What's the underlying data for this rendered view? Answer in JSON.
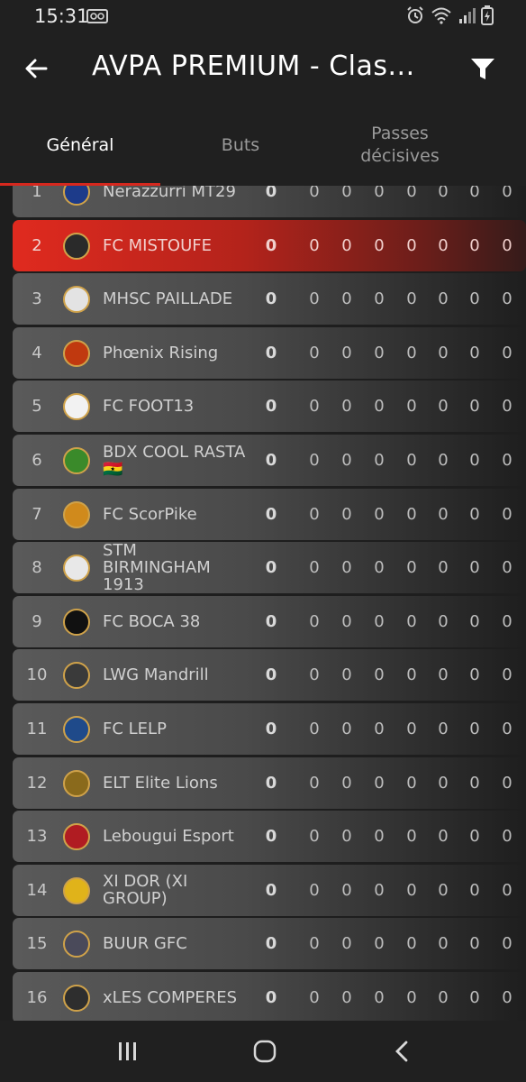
{
  "status_bar": {
    "time": "15:31"
  },
  "app_bar": {
    "title": "AVPA PREMIUM - Clas..."
  },
  "tabs": [
    {
      "label": "Général"
    },
    {
      "label": "Buts"
    },
    {
      "label": "Passes décisives"
    }
  ],
  "rows": [
    {
      "rank": "1",
      "team": "Nerazzurri MT29",
      "logo_color": "#1d3b8a",
      "stats": [
        "0",
        "0",
        "0",
        "0",
        "0",
        "0",
        "0",
        "0"
      ]
    },
    {
      "rank": "2",
      "team": "FC MISTOUFE",
      "logo_color": "#2a2a2a",
      "stats": [
        "0",
        "0",
        "0",
        "0",
        "0",
        "0",
        "0",
        "0"
      ]
    },
    {
      "rank": "3",
      "team": "MHSC PAILLADE",
      "logo_color": "#e3e3e3",
      "stats": [
        "0",
        "0",
        "0",
        "0",
        "0",
        "0",
        "0",
        "0"
      ]
    },
    {
      "rank": "4",
      "team": "Phœnix Rising",
      "logo_color": "#c0390f",
      "stats": [
        "0",
        "0",
        "0",
        "0",
        "0",
        "0",
        "0",
        "0"
      ]
    },
    {
      "rank": "5",
      "team": "FC FOOT13",
      "logo_color": "#f2f2f2",
      "stats": [
        "0",
        "0",
        "0",
        "0",
        "0",
        "0",
        "0",
        "0"
      ]
    },
    {
      "rank": "6",
      "team": "BDX COOL RASTA 🇬🇭",
      "logo_color": "#3a8a2a",
      "stats": [
        "0",
        "0",
        "0",
        "0",
        "0",
        "0",
        "0",
        "0"
      ]
    },
    {
      "rank": "7",
      "team": "FC ScorPike",
      "logo_color": "#d08a1c",
      "stats": [
        "0",
        "0",
        "0",
        "0",
        "0",
        "0",
        "0",
        "0"
      ]
    },
    {
      "rank": "8",
      "team": "STM BIRMINGHAM 1913",
      "logo_color": "#e8e8e8",
      "stats": [
        "0",
        "0",
        "0",
        "0",
        "0",
        "0",
        "0",
        "0"
      ]
    },
    {
      "rank": "9",
      "team": "FC BOCA 38",
      "logo_color": "#111111",
      "stats": [
        "0",
        "0",
        "0",
        "0",
        "0",
        "0",
        "0",
        "0"
      ]
    },
    {
      "rank": "10",
      "team": "LWG Mandrill",
      "logo_color": "#3a3a3a",
      "stats": [
        "0",
        "0",
        "0",
        "0",
        "0",
        "0",
        "0",
        "0"
      ]
    },
    {
      "rank": "11",
      "team": "FC LELP",
      "logo_color": "#1f4a8a",
      "stats": [
        "0",
        "0",
        "0",
        "0",
        "0",
        "0",
        "0",
        "0"
      ]
    },
    {
      "rank": "12",
      "team": "ELT Elite Lions",
      "logo_color": "#8a6a1c",
      "stats": [
        "0",
        "0",
        "0",
        "0",
        "0",
        "0",
        "0",
        "0"
      ]
    },
    {
      "rank": "13",
      "team": "Lebougui Esport",
      "logo_color": "#b01c22",
      "stats": [
        "0",
        "0",
        "0",
        "0",
        "0",
        "0",
        "0",
        "0"
      ]
    },
    {
      "rank": "14",
      "team": "XI DOR (XI GROUP)",
      "logo_color": "#e0b31a",
      "stats": [
        "0",
        "0",
        "0",
        "0",
        "0",
        "0",
        "0",
        "0"
      ]
    },
    {
      "rank": "15",
      "team": "BUUR GFC",
      "logo_color": "#4a4a5a",
      "stats": [
        "0",
        "0",
        "0",
        "0",
        "0",
        "0",
        "0",
        "0"
      ]
    },
    {
      "rank": "16",
      "team": "xLES COMPERES",
      "logo_color": "#2e2e2e",
      "stats": [
        "0",
        "0",
        "0",
        "0",
        "0",
        "0",
        "0",
        "0"
      ]
    }
  ],
  "colors": {
    "accent": "#d6281e",
    "highlight_row": "#e02a1f",
    "background": "#1f1f1f"
  }
}
